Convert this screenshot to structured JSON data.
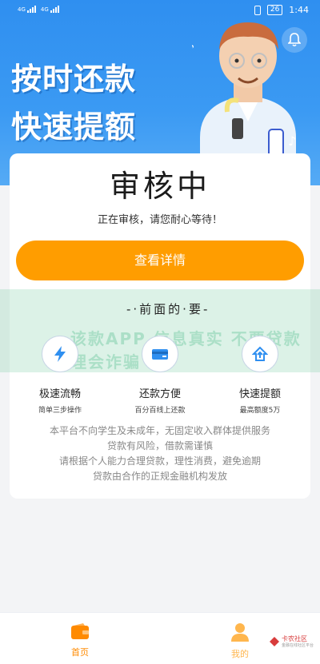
{
  "status_bar": {
    "network_left": "4G",
    "network_right": "4G",
    "battery": "26",
    "time": "1:44"
  },
  "banner": {
    "line1": "按时还款",
    "line2": "快速提额"
  },
  "card": {
    "status_title": "审核中",
    "status_sub": "正在审核，请您耐心等待！",
    "detail_button": "查看详情",
    "handwriting": "-·前面的·要-",
    "overlay_text": "该款APP 信息真实 不要贷款 理会诈骗",
    "features": [
      {
        "title": "极速流畅",
        "sub": "简单三步操作",
        "icon": "lightning-icon"
      },
      {
        "title": "还款方便",
        "sub": "百分百线上还款",
        "icon": "wallet-card-icon"
      },
      {
        "title": "快速提额",
        "sub": "最高额度5万",
        "icon": "house-up-icon"
      }
    ],
    "notice_lines": [
      "本平台不向学生及未成年，无固定收入群体提供服务",
      "贷款有风险，借款需谨慎",
      "请根据个人能力合理贷款，理性消费，避免逾期",
      "贷款由合作的正规金融机构发放"
    ]
  },
  "tabbar": {
    "home": "首页",
    "mine": "我的",
    "watermark": "卡农社区",
    "watermark_sub": "金融在线社区平台"
  },
  "colors": {
    "primary_blue": "#2f8ff0",
    "accent_orange": "#ff9d00",
    "tab_active": "#ff8a00"
  }
}
